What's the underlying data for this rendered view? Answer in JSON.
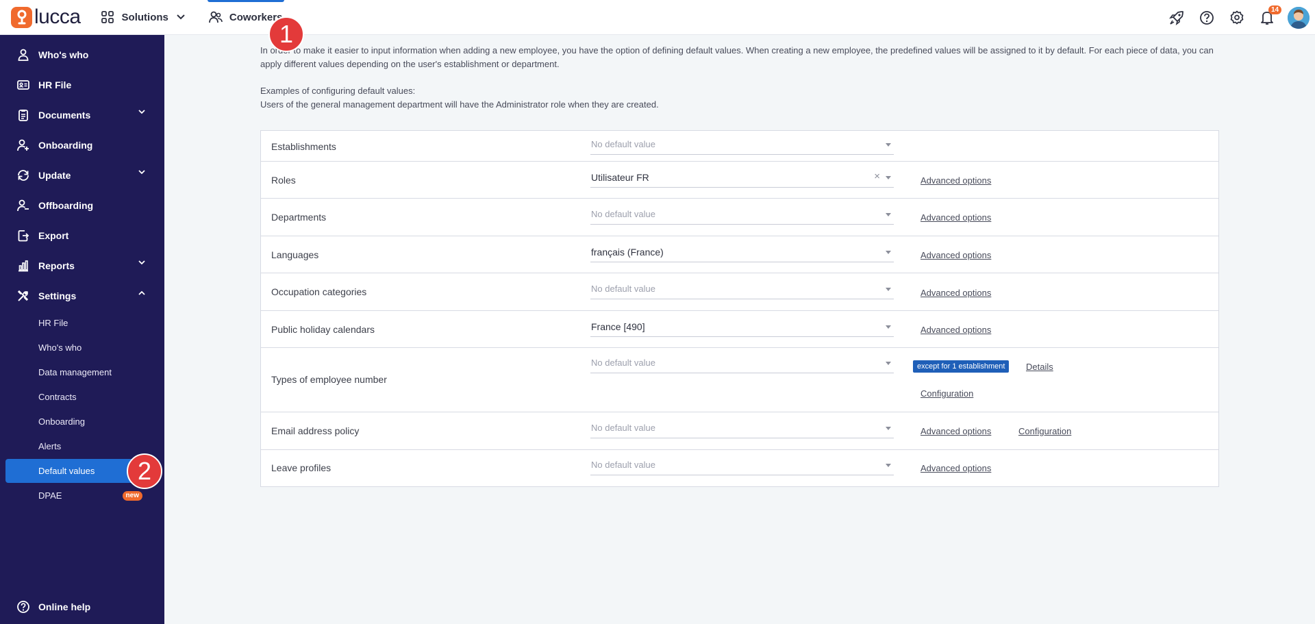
{
  "brand": {
    "name": "lucca",
    "accent": "#f06a2d",
    "primary": "#1f6ed4",
    "sidebar_bg": "#1f1b57"
  },
  "topbar": {
    "solutions_label": "Solutions",
    "coworkers_label": "Coworkers",
    "notifications_count": "14",
    "icons": [
      "rocket-icon",
      "help-icon",
      "gear-icon",
      "bell-icon",
      "avatar"
    ]
  },
  "sidebar": {
    "items": [
      {
        "label": "Who's who",
        "icon": "person-icon"
      },
      {
        "label": "HR File",
        "icon": "id-card-icon"
      },
      {
        "label": "Documents",
        "icon": "clipboard-icon",
        "expandable": true
      },
      {
        "label": "Onboarding",
        "icon": "person-add-icon"
      },
      {
        "label": "Update",
        "icon": "refresh-icon",
        "expandable": true
      },
      {
        "label": "Offboarding",
        "icon": "person-icon"
      },
      {
        "label": "Export",
        "icon": "export-icon"
      },
      {
        "label": "Reports",
        "icon": "chart-icon",
        "expandable": true
      },
      {
        "label": "Settings",
        "icon": "tools-icon",
        "expanded": true
      }
    ],
    "settings_sub": [
      {
        "label": "HR File"
      },
      {
        "label": "Who's who"
      },
      {
        "label": "Data management"
      },
      {
        "label": "Contracts"
      },
      {
        "label": "Onboarding"
      },
      {
        "label": "Alerts"
      },
      {
        "label": "Default values",
        "active": true
      },
      {
        "label": "DPAE",
        "badge": "new"
      }
    ],
    "help_label": "Online help"
  },
  "intro": {
    "paragraph": "In order to make it easier to input information when adding a new employee, you have the option of defining default values. When creating a new employee, the predefined values will be assigned to it by default. For each piece of data, you can apply different values depending on the user's establishment or department.",
    "examples_title": "Examples of configuring default values:",
    "examples_text": "Users of the general management department will have the Administrator role when they are created."
  },
  "table": {
    "placeholder": "No default value",
    "advanced_label": "Advanced options",
    "configuration_label": "Configuration",
    "details_label": "Details",
    "rows": [
      {
        "label": "Establishments",
        "value": ""
      },
      {
        "label": "Roles",
        "value": "Utilisateur FR"
      },
      {
        "label": "Departments",
        "value": ""
      },
      {
        "label": "Languages",
        "value": "français (France)"
      },
      {
        "label": "Occupation categories",
        "value": ""
      },
      {
        "label": "Public holiday calendars",
        "value": "France [490]"
      },
      {
        "label": "Types of employee number",
        "value": "",
        "tag": "except for 1 establishment"
      },
      {
        "label": "Email address policy",
        "value": ""
      },
      {
        "label": "Leave profiles",
        "value": ""
      }
    ]
  },
  "markers": {
    "step1": "1",
    "step2": "2"
  }
}
